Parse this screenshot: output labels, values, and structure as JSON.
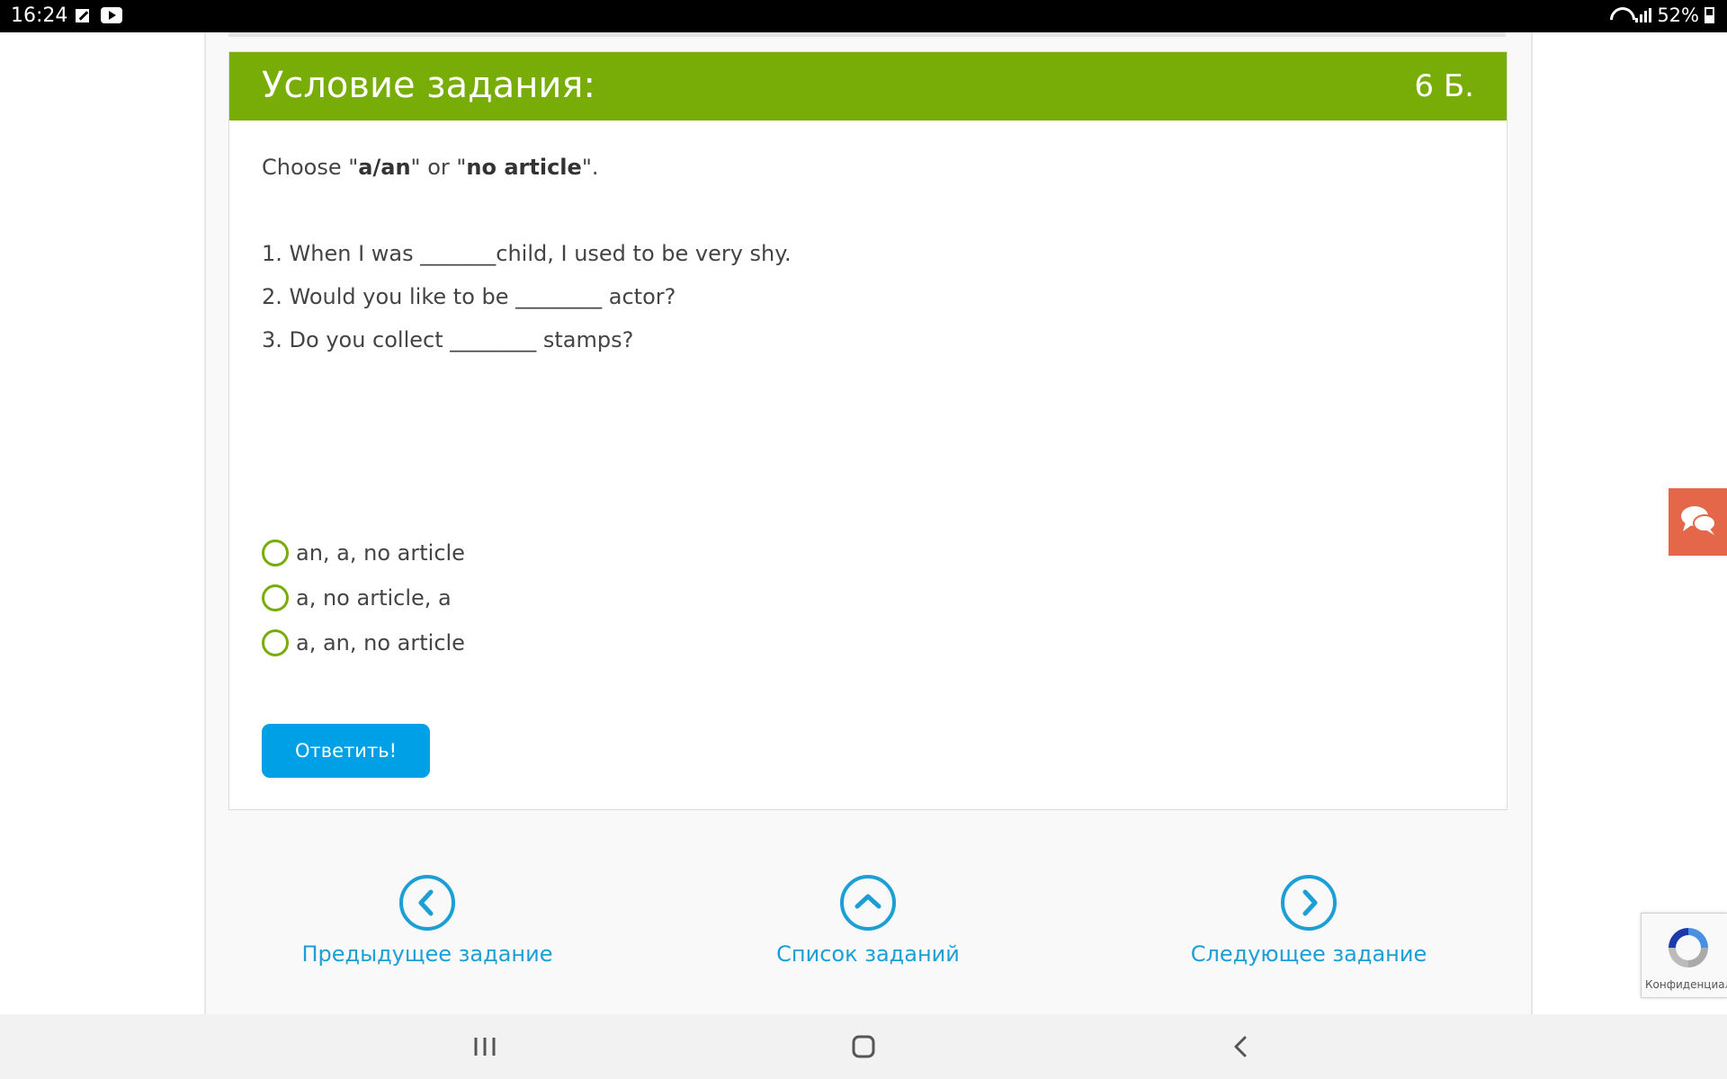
{
  "status_bar": {
    "time": "16:24",
    "battery": "52%"
  },
  "task": {
    "header_title": "Условие задания:",
    "points": "6 Б.",
    "instruction": {
      "prefix": "Choose \"",
      "bold1": "a/an",
      "middle": "\" or \"",
      "bold2": "no article",
      "suffix": "\"."
    },
    "questions": [
      "1. When I was _______child, I used to be very shy.",
      "2. Would you like to be ________ actor?",
      "3. Do you collect ________ stamps?"
    ],
    "options": [
      "an, a, no article",
      "a, no article, a",
      "a, an, no article"
    ],
    "submit_label": "Ответить!"
  },
  "navigation": {
    "prev_label": "Предыдущее задание",
    "list_label": "Список заданий",
    "next_label": "Следующее задание"
  },
  "recaptcha": {
    "text": "Конфиденциальн"
  },
  "colors": {
    "header_green": "#78ac06",
    "button_blue": "#00a0e6",
    "nav_blue": "#1b9fd6",
    "chat_orange": "#e5674a"
  },
  "icons": [
    "edit-icon",
    "youtube-icon",
    "wifi-icon",
    "signal-icon",
    "battery-icon",
    "chevron-left-icon",
    "chevron-up-icon",
    "chevron-right-icon",
    "chat-icon",
    "recaptcha-icon",
    "recents-icon",
    "home-icon",
    "back-icon"
  ]
}
